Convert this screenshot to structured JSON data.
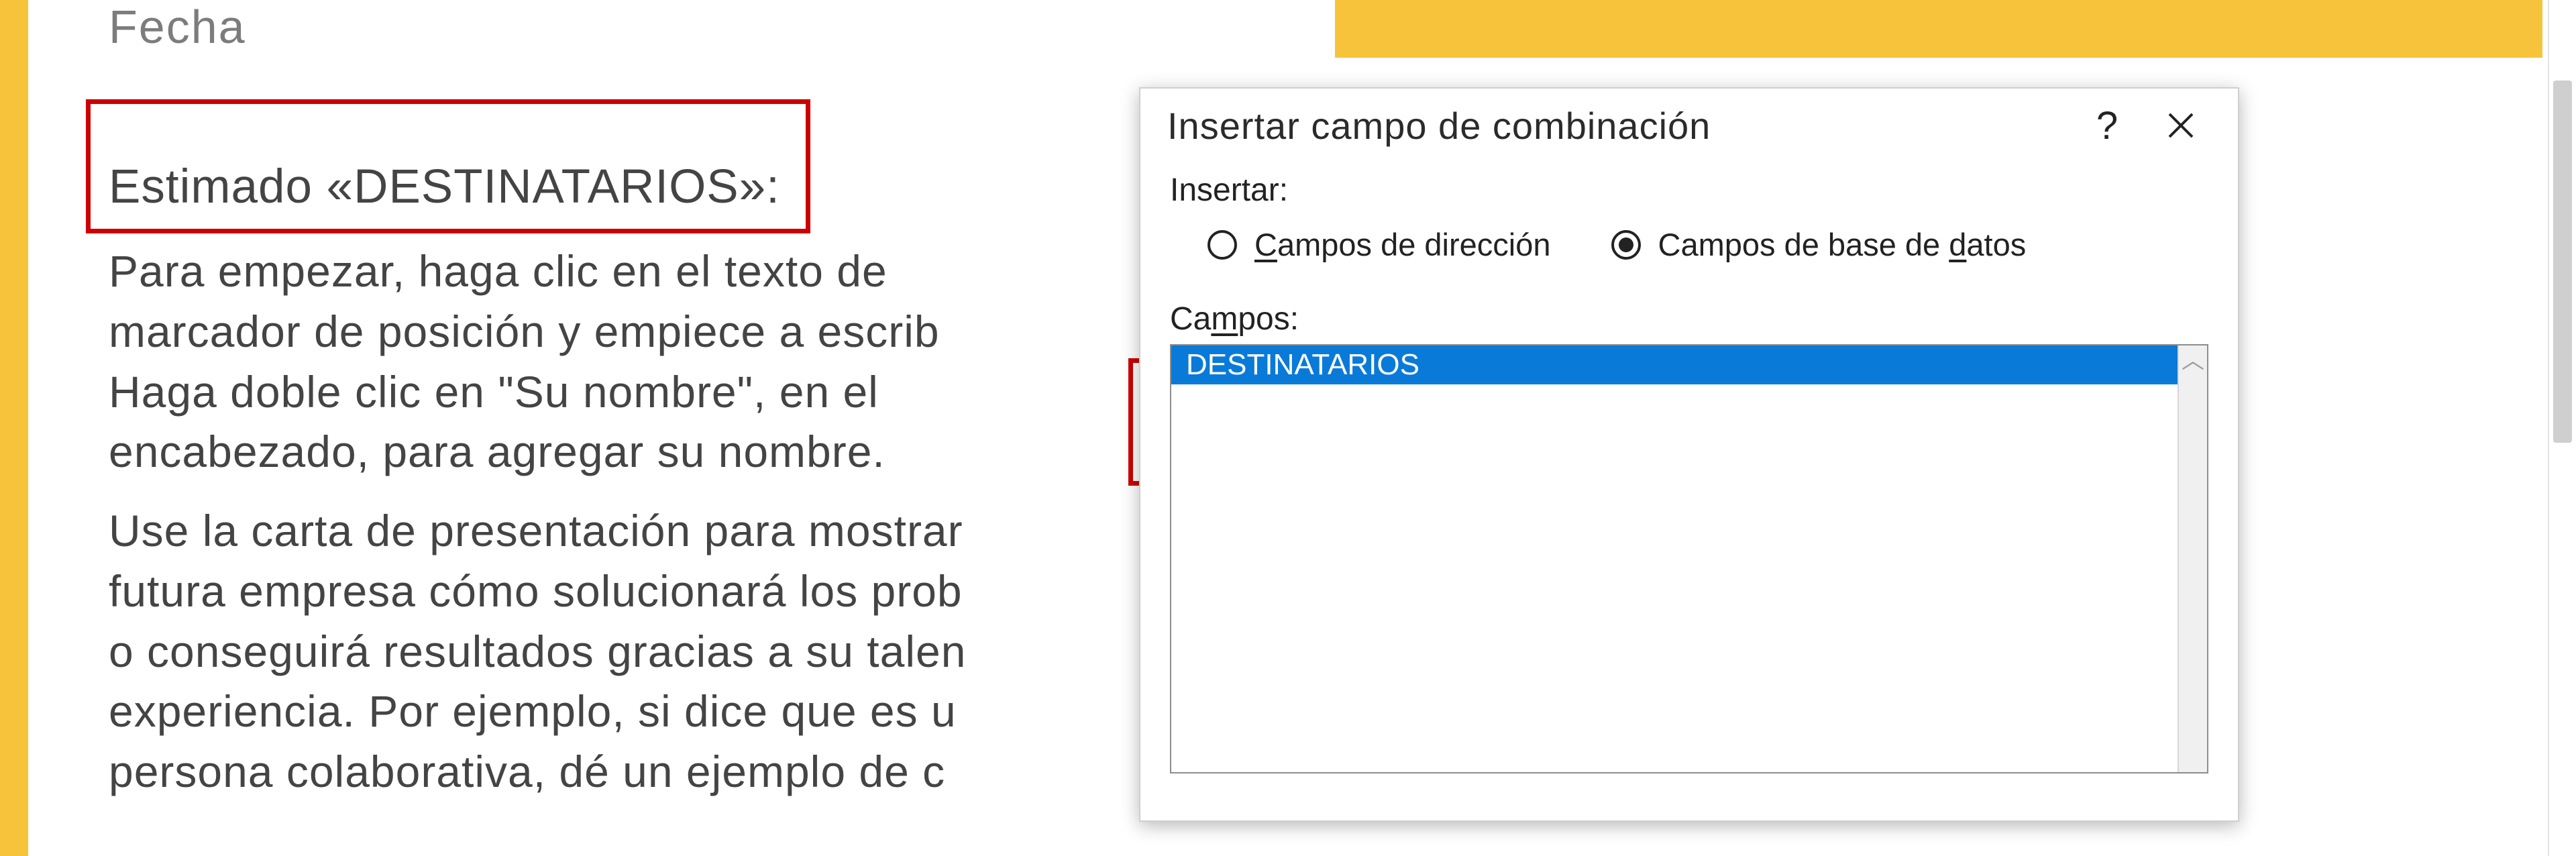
{
  "document": {
    "fecha_placeholder": "Fecha",
    "greeting": "Estimado «DESTINATARIOS»:",
    "body_p1_l1": "Para empezar, haga clic en el texto de",
    "body_p1_l2": "marcador de posición y empiece a escrib",
    "body_p1_l3": "Haga doble clic en \"Su nombre\", en el",
    "body_p1_l4": "encabezado, para agregar su nombre.",
    "body_p2_l1": "Use la carta de presentación para mostrar",
    "body_p2_l2": "futura empresa cómo solucionará los prob",
    "body_p2_l3": "o conseguirá resultados gracias a su talen",
    "body_p2_l4": "experiencia. Por ejemplo, si dice que es u",
    "body_p2_l5": "persona colaborativa, dé un ejemplo de c"
  },
  "dialog": {
    "title": "Insertar campo de combinación",
    "insert_label": "Insertar:",
    "radio_address_pre": "C",
    "radio_address_rest": "ampos de dirección",
    "radio_db_pre": "Campos de base de ",
    "radio_db_ul": "d",
    "radio_db_post": "atos",
    "fields_label_pre": "Ca",
    "fields_label_ul": "m",
    "fields_label_post": "pos:",
    "field_items": [
      "DESTINATARIOS"
    ]
  }
}
